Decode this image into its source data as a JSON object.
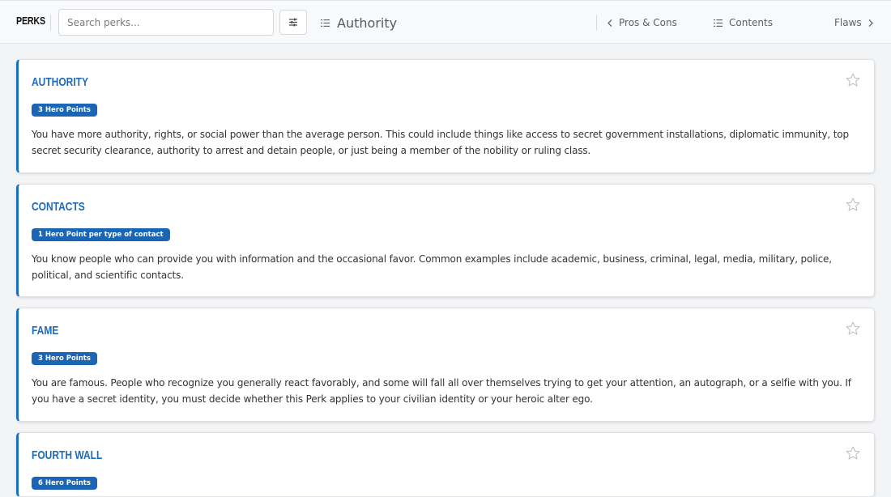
{
  "app": {
    "brand": "PERKS"
  },
  "search": {
    "placeholder": "Search perks...",
    "value": ""
  },
  "header": {
    "title": "Authority",
    "prev_label": "Pros & Cons",
    "contents_label": "Contents",
    "next_label": "Flaws"
  },
  "colors": {
    "accent": "#1b6fbf",
    "badge": "#1b65b5",
    "title": "#1d6bb8"
  },
  "perks": [
    {
      "title": "AUTHORITY",
      "cost": "3 Hero Points",
      "description": "You have more authority, rights, or social power than the average person. This could include things like access to secret government installations, diplomatic immunity, top secret security clearance, authority to arrest and detain people, or just being a member of the nobility or ruling class."
    },
    {
      "title": "CONTACTS",
      "cost": "1 Hero Point per type of contact",
      "description": "You know people who can provide you with information and the occasional favor. Common examples include academic, business, criminal, legal, media, military, police, political, and scientific contacts."
    },
    {
      "title": "FAME",
      "cost": "3 Hero Points",
      "description": "You are famous. People who recognize you generally react favorably, and some will fall all over themselves trying to get your attention, an autograph, or a selfie with you. If you have a secret identity, you must decide whether this Perk applies to your civilian identity or your heroic alter ego."
    },
    {
      "title": "FOURTH WALL",
      "cost": "6 Hero Points",
      "description": ""
    }
  ]
}
